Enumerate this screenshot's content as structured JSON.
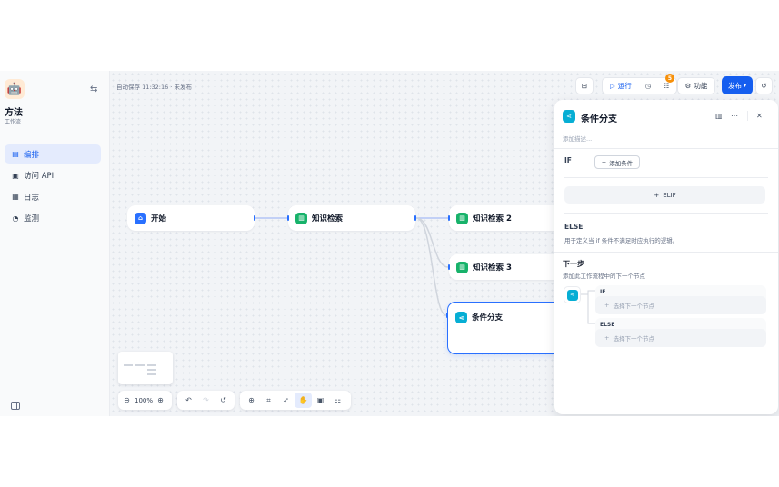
{
  "sidebar": {
    "app_name": "方法",
    "app_type": "工作流",
    "items": [
      {
        "label": "编排",
        "icon": "layout-icon",
        "active": true
      },
      {
        "label": "访问 API",
        "icon": "api-icon",
        "active": false
      },
      {
        "label": "日志",
        "icon": "log-icon",
        "active": false
      },
      {
        "label": "监测",
        "icon": "monitor-icon",
        "active": false
      }
    ]
  },
  "header": {
    "autosave": "自动保存 11:32:16 · 未发布",
    "run_label": "运行",
    "badge_count": "5",
    "features_label": "功能",
    "publish_label": "发布"
  },
  "nodes": {
    "start": "开始",
    "knowledge1": "知识检索",
    "knowledge2": "知识检索 2",
    "knowledge3": "知识检索 3",
    "condition": "条件分支"
  },
  "toolbar": {
    "zoom": "100%"
  },
  "panel": {
    "title": "条件分支",
    "description_placeholder": "添加描述...",
    "if_label": "IF",
    "add_condition_label": "添加条件",
    "elif_label": "ELIF",
    "else_label": "ELSE",
    "else_description": "用于定义当 if 条件不满足时应执行的逻辑。",
    "next_step_title": "下一步",
    "next_step_description": "添加此工作流程中的下一个节点",
    "branches": [
      {
        "label": "IF",
        "placeholder": "选择下一个节点"
      },
      {
        "label": "ELSE",
        "placeholder": "选择下一个节点"
      }
    ]
  },
  "colors": {
    "accent": "#155eef",
    "start_node": "#2970ff",
    "knowledge_node": "#17b26a",
    "condition_node": "#06aed4",
    "badge": "#f79009"
  }
}
